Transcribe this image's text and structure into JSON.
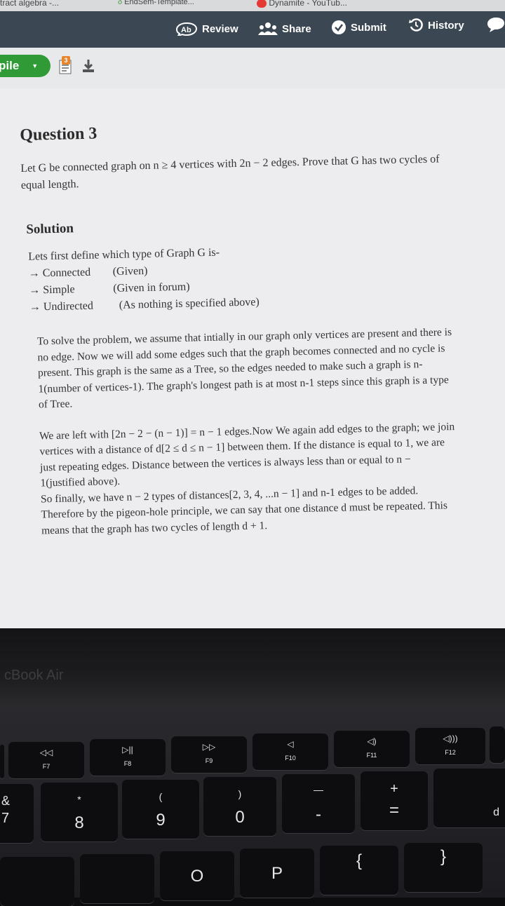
{
  "tabs": [
    {
      "label": "tract algebra -..."
    },
    {
      "label": "EndSem-Template..."
    },
    {
      "label": "Dynamite - YouTub..."
    }
  ],
  "toolbar": {
    "review": "Review",
    "share": "Share",
    "submit": "Submit",
    "history": "History"
  },
  "subbar": {
    "compile": "pile",
    "badge": "3"
  },
  "document": {
    "question_title": "Question 3",
    "question_text": "Let G be connected graph on n ≥ 4 vertices with 2n − 2 edges. Prove that G has two cycles of equal length.",
    "solution_title": "Solution",
    "definition_intro": "Lets first define which type of Graph G is-",
    "definitions": [
      {
        "key": "→ Connected",
        "value": "(Given)"
      },
      {
        "key": "→ Simple",
        "value": "(Given in forum)"
      },
      {
        "key": "→ Undirected",
        "value": "(As nothing is specified above)"
      }
    ],
    "paragraph1": "To solve the problem, we assume that intially in our graph only vertices are present and there is no edge. Now we will add some edges such that the graph becomes connected and no cycle is present. This graph is the same as a Tree, so the edges needed to make such a graph is n-1(number of vertices-1). The graph's longest path is at most n-1 steps since this graph is a type of Tree.",
    "paragraph2_lines": [
      "We are left with [2n − 2 − (n − 1)] = n − 1 edges.Now We again add edges to the graph; we join vertices with a distance of d[2 ≤ d ≤ n − 1] between them. If the distance is equal to 1, we are just repeating edges. Distance between the vertices is always less than or equal to n − 1(justified above).",
      "So finally, we have n − 2 types of distances[2, 3, 4, ...n − 1] and n-1 edges to be added. Therefore by the pigeon-hole principle, we can say that one distance d must be repeated. This means that the graph has two cycles of length d + 1."
    ]
  },
  "laptop": {
    "brand": "cBook Air",
    "fkeys": [
      "F7",
      "F8",
      "F9",
      "F10",
      "F11",
      "F12"
    ],
    "fkey_icons": [
      "rewind-icon",
      "play-pause-icon",
      "fast-forward-icon",
      "volume-mute-icon",
      "volume-down-icon",
      "volume-up-icon"
    ],
    "number_keys": [
      {
        "top": "&",
        "bottom": "7"
      },
      {
        "top": "*",
        "bottom": "8"
      },
      {
        "top": "(",
        "bottom": "9"
      },
      {
        "top": ")",
        "bottom": "0"
      },
      {
        "top": "—",
        "bottom": "-"
      },
      {
        "top": "+",
        "bottom": "="
      },
      {
        "top": "",
        "bottom": "d"
      }
    ],
    "letter_keys": [
      "O",
      "P",
      "{",
      "}"
    ]
  },
  "colors": {
    "toolbar": "#3b4753",
    "compile_green": "#2f9a36",
    "badge_orange": "#e8842a",
    "paper": "#ededef"
  }
}
